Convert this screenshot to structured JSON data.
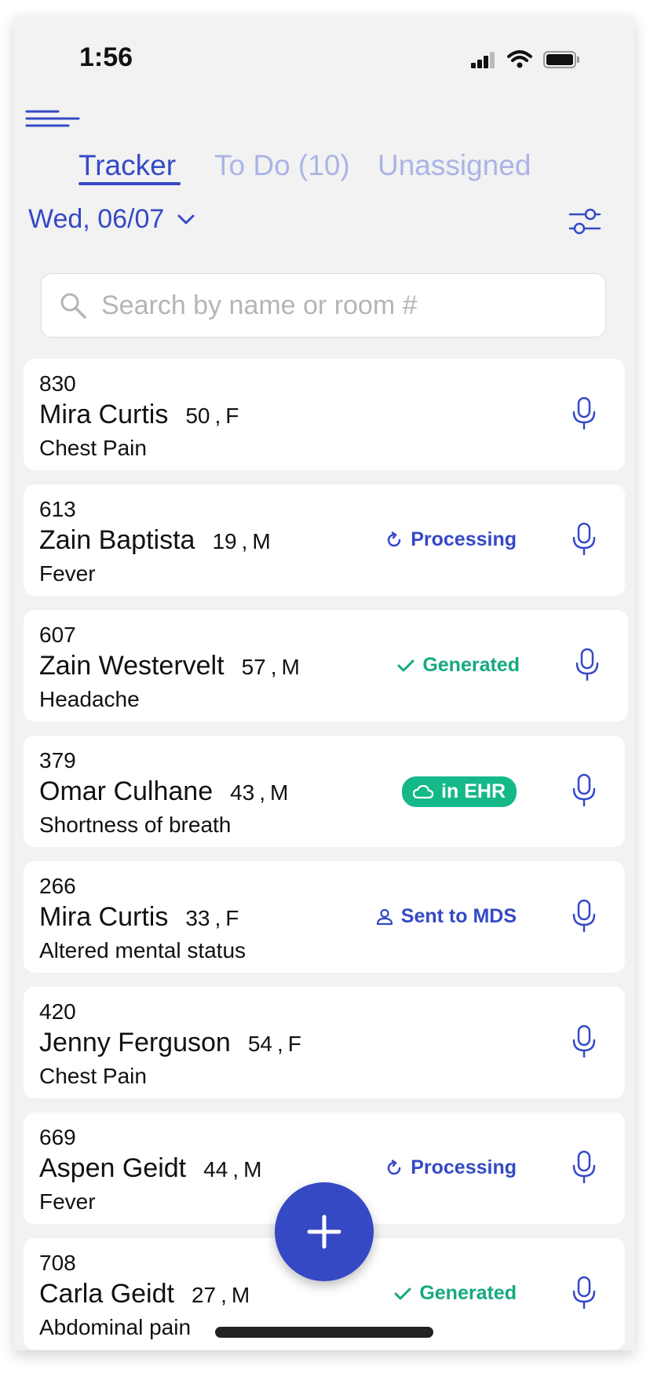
{
  "status_bar": {
    "time": "1:56"
  },
  "tabs": [
    {
      "label": "Tracker",
      "active": true
    },
    {
      "label": "To Do (10)",
      "active": false
    },
    {
      "label": "Unassigned",
      "active": false
    }
  ],
  "date": {
    "label": "Wed, 06/07"
  },
  "search": {
    "placeholder": "Search by name or room #"
  },
  "patients": [
    {
      "room": "830",
      "name": "Mira Curtis",
      "age": "50",
      "sex": "F",
      "complaint": "Chest Pain",
      "status": ""
    },
    {
      "room": "613",
      "name": "Zain Baptista",
      "age": "19",
      "sex": "M",
      "complaint": "Fever",
      "status": "Processing"
    },
    {
      "room": "607",
      "name": "Zain Westervelt",
      "age": "57",
      "sex": "M",
      "complaint": "Headache",
      "status": "Generated"
    },
    {
      "room": "379",
      "name": "Omar Culhane",
      "age": "43",
      "sex": "M",
      "complaint": "Shortness of breath",
      "status": "in EHR"
    },
    {
      "room": "266",
      "name": "Mira Curtis",
      "age": "33",
      "sex": "F",
      "complaint": "Altered mental status",
      "status": "Sent to MDS"
    },
    {
      "room": "420",
      "name": "Jenny Ferguson",
      "age": "54",
      "sex": "F",
      "complaint": "Chest Pain",
      "status": ""
    },
    {
      "room": "669",
      "name": "Aspen Geidt",
      "age": "44",
      "sex": "M",
      "complaint": "Fever",
      "status": "Processing"
    },
    {
      "room": "708",
      "name": "Carla Geidt",
      "age": "27",
      "sex": "M",
      "complaint": "Abdominal pain",
      "status": "Generated"
    }
  ],
  "separator": ",",
  "colors": {
    "accent": "#3549c5",
    "tab_inactive": "#aab4e6",
    "success": "#15a981",
    "ehr_badge": "#15b888",
    "background": "#f2f2f2"
  },
  "icons": [
    "menu-icon",
    "filter-icon",
    "search-icon",
    "chevron-down-icon",
    "mic-icon",
    "refresh-icon",
    "check-icon",
    "cloud-icon",
    "user-icon",
    "plus-icon"
  ]
}
